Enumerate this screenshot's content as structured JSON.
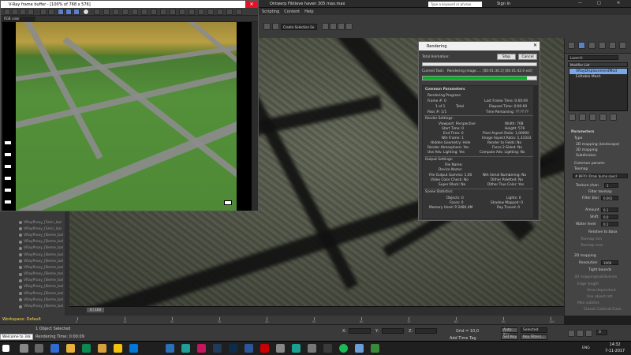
{
  "app": {
    "title": "Ontwerp Fiktieve haven 305 max.max",
    "menu": [
      "Scripting",
      "Content",
      "Help"
    ],
    "search_placeholder": "Type a keyword or phrase",
    "sign_in": "Sign In",
    "selection_set": "Create Selection Se"
  },
  "frame_buffer": {
    "title": "V-Ray frame buffer - [100% of 768 x 576]",
    "channel": "RGB color"
  },
  "scene_explorer": {
    "items": [
      "VRayProxy_[Smic_bal",
      "VRayProxy_[Smic_bal",
      "VRayProxy_[Beme_bal",
      "VRayProxy_[Beme_bal",
      "VRayProxy_[Beme_bal",
      "VRayProxy_[Beme_bal",
      "VRayProxy_[Beme_bal",
      "VRayProxy_[Beme_bal",
      "VRayProxy_[Beme_bal",
      "VRayProxy_[Beme_bal",
      "VRayProxy_[Beme_bal",
      "VRayProxy_[Beme_bal",
      "VRayProxy_[Beme_bal",
      "VRayProxy_[Beme_bal"
    ],
    "workspace": "Workspace: Default"
  },
  "render_dialog": {
    "title": "Rendering",
    "total_animation": "Total Animation:",
    "stop": "Stop",
    "cancel": "Cancel",
    "current_task_label": "Current Task:",
    "current_task": "Rendering image..... [00:01:30.2] [00:01:42.0 est]",
    "progress": 0.92,
    "common_params": "Common Parameters",
    "rendering_progress": "Rendering Progress:",
    "frame": "Frame #: 0",
    "last_frame_time": "Last Frame Time: 0:00:09",
    "of": "1 of 1",
    "total": "Total",
    "elapsed": "Elapsed Time: 0:00:00",
    "pass": "Pass #: 1/1",
    "time_remaining": "Time Remaining: ??:??:??",
    "render_settings": "Render Settings:",
    "viewport": "Viewport: Perspective",
    "width": "Width: 768",
    "start_time": "Start Time: 0",
    "height": "Height: 576",
    "end_time": "End Time: 0",
    "pixel_aspect": "Pixel Aspect Ratio: 1,00000",
    "nth_frame": "Nth Frame: 1",
    "image_aspect": "Image Aspect Ratio: 1,33333",
    "hidden_geo": "Hidden Geometry: Hide",
    "render_fields": "Render to Fields: No",
    "atmos": "Render Atmosphere: Yes",
    "force2": "Force 2-Sided: No",
    "adv_light": "Use Adv. Lighting: Yes",
    "compute_adv": "Compute Adv. Lighting: No",
    "output_settings": "Output Settings:",
    "file_name": "File Name:",
    "device_name": "Device Name:",
    "gamma": "File Output Gamma: 1,00",
    "nth_serial": "Nth Serial Numbering: No",
    "video_check": "Video Color Check: No",
    "dither_pal": "Dither Paletted: No",
    "super_black": "Super Black: No",
    "dither_true": "Dither True Color: Yes",
    "scene_stats": "Scene Statistics:",
    "objects": "Objects: 0",
    "lights": "Lights: 0",
    "faces": "Faces: 0",
    "shadow_mapped": "Shadow Mapped: 0",
    "memory": "Memory Used: P:2480,4M",
    "ray_traced": "Ray Traced: 0"
  },
  "command_panel": {
    "object_name": "Layer:0-",
    "modifier_list": "Modifier List",
    "modifiers": [
      "VRayDisplacementMod",
      "Editable Mesh"
    ],
    "parameters": "Parameters",
    "type": "Type",
    "type_opts": [
      "2D mapping (landscape)",
      "3D mapping",
      "Subdivision"
    ],
    "common_params": "Common params",
    "texmap": "Texmap",
    "texmap_val": "# 8970 (Draai bump spec)",
    "texture_chan": "Texture chan",
    "texture_chan_val": "1",
    "filter_texmap": "Filter texmap",
    "filter_blur": "Filter blur",
    "filter_blur_val": "0,001",
    "amount": "Amount",
    "amount_val": "0,1",
    "shift": "Shift",
    "shift_val": "0,0",
    "water_level": "Water level",
    "water_level_val": "0,1",
    "relative_bbox": "Relative to bbox",
    "texmap_min": "Texmap min",
    "texmap_max": "Texmap max",
    "mapping_2d": "2D mapping",
    "resolution": "Resolution",
    "resolution_val": "1000",
    "tight_bounds": "Tight bounds",
    "subdiv_section": "3D mapping/subdivision",
    "edge_length": "Edge length",
    "view_dependent": "View-dependent",
    "use_object_mtl": "Use object mtl",
    "max_subdivs": "Max subdivs",
    "classic_catmull": "Classic Catmull-Clark",
    "smooth_uvs": "Smooth UVs"
  },
  "timeline": {
    "slider": "0 / 100",
    "ticks": [
      "0",
      "10",
      "20",
      "30",
      "40",
      "50",
      "60",
      "70",
      "80",
      "90",
      "100"
    ]
  },
  "status": {
    "selected": "1 Object Selected",
    "render_time": "Rendering Time: 0:00:09",
    "maxscript": "Welcome to 3ds",
    "x": "X:",
    "y": "Y:",
    "z": "Z:",
    "grid": "Grid = 10,0",
    "add_time_tag": "Add Time Tag",
    "auto_key": "Auto Key",
    "set_key": "Set Key",
    "selected_dd": "Selected",
    "key_filters": "Key Filters...",
    "frame": "0"
  },
  "taskbar": {
    "time": "14:32",
    "date": "7-11-2017",
    "lang": "ENG"
  }
}
